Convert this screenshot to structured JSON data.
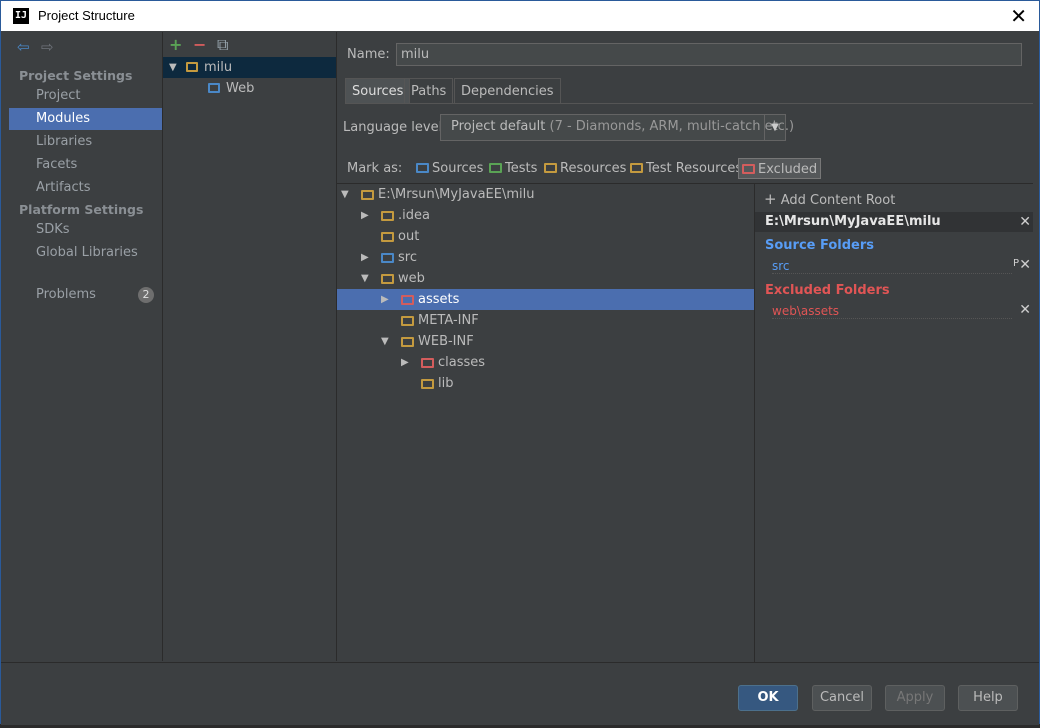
{
  "window": {
    "title": "Project Structure",
    "logo": "IJ"
  },
  "nav": {
    "project_settings": "Project Settings",
    "items_top": [
      "Project",
      "Modules",
      "Libraries",
      "Facets",
      "Artifacts"
    ],
    "platform_settings": "Platform Settings",
    "items_platform": [
      "SDKs",
      "Global Libraries"
    ],
    "problems": "Problems",
    "problems_count": "2",
    "selected": "Modules"
  },
  "modules": {
    "tree": [
      {
        "label": "milu",
        "level": 0,
        "expanded": true,
        "selected": true,
        "icon": "module-folder-icon"
      },
      {
        "label": "Web",
        "level": 1,
        "selected": false,
        "icon": "web-facet-icon"
      }
    ]
  },
  "module_detail": {
    "name_label": "Name:",
    "name_value": "milu",
    "tabs": [
      "Sources",
      "Paths",
      "Dependencies"
    ],
    "active_tab": "Sources",
    "language_level_label": "Language level:",
    "language_level_value": "Project default",
    "language_level_sub": "(7 - Diamonds, ARM, multi-catch etc.)",
    "mark_as_label": "Mark as:",
    "mark_as": [
      {
        "label": "Sources",
        "color": "#4a88c7"
      },
      {
        "label": "Tests",
        "color": "#5aa355"
      },
      {
        "label": "Resources",
        "color": "#c49a3f"
      },
      {
        "label": "Test Resources",
        "color": "#c49a3f"
      },
      {
        "label": "Excluded",
        "color": "#d35d5d"
      }
    ],
    "tree": [
      {
        "label": "E:\\Mrsun\\MyJavaEE\\milu",
        "level": 0,
        "expand": "open",
        "color": "#c49a3f"
      },
      {
        "label": ".idea",
        "level": 1,
        "expand": "closed",
        "color": "#c49a3f"
      },
      {
        "label": "out",
        "level": 1,
        "expand": "none",
        "color": "#c49a3f"
      },
      {
        "label": "src",
        "level": 1,
        "expand": "closed",
        "color": "#4a88c7"
      },
      {
        "label": "web",
        "level": 1,
        "expand": "open",
        "color": "#c49a3f"
      },
      {
        "label": "assets",
        "level": 2,
        "expand": "closed",
        "color": "#d35d5d",
        "selected": true
      },
      {
        "label": "META-INF",
        "level": 2,
        "expand": "none",
        "color": "#c49a3f"
      },
      {
        "label": "WEB-INF",
        "level": 2,
        "expand": "open",
        "color": "#c49a3f"
      },
      {
        "label": "classes",
        "level": 3,
        "expand": "closed",
        "color": "#d35d5d"
      },
      {
        "label": "lib",
        "level": 3,
        "expand": "none",
        "color": "#c49a3f"
      }
    ]
  },
  "content_roots": {
    "add_label": "Add Content Root",
    "root_path": "E:\\Mrsun\\MyJavaEE\\milu",
    "source_heading": "Source Folders",
    "source_color": "#589df6",
    "source_items": [
      "src"
    ],
    "excluded_heading": "Excluded Folders",
    "excluded_color": "#e05555",
    "excluded_items": [
      "web\\assets"
    ]
  },
  "footer": {
    "ok": "OK",
    "cancel": "Cancel",
    "apply": "Apply",
    "help": "Help"
  }
}
